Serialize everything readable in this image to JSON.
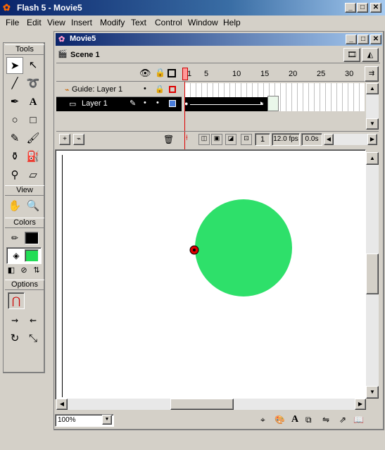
{
  "app": {
    "title": "Flash 5 - Movie5",
    "title_buttons": [
      "_",
      "□",
      "✕"
    ]
  },
  "menu": [
    "File",
    "Edit",
    "View",
    "Insert",
    "Modify",
    "Text",
    "Control",
    "Window",
    "Help"
  ],
  "toolbox": {
    "tools_label": "Tools",
    "view_label": "View",
    "colors_label": "Colors",
    "options_label": "Options",
    "stroke_color": "#000000",
    "fill_color": "#22dd55"
  },
  "movie": {
    "title": "Movie5",
    "scene": "Scene 1",
    "frame_numbers": [
      "1",
      "5",
      "10",
      "15",
      "20",
      "25",
      "30"
    ],
    "layers": [
      {
        "name": "Guide: Layer 1",
        "selected": false
      },
      {
        "name": "Layer 1",
        "selected": true
      }
    ],
    "current_frame": "1",
    "fps": "12.0 fps",
    "time": "0.0s"
  },
  "stage": {
    "circle_color": "#2ee06a",
    "registration_color": "#dd0000"
  },
  "statusbar": {
    "zoom": "100%"
  }
}
